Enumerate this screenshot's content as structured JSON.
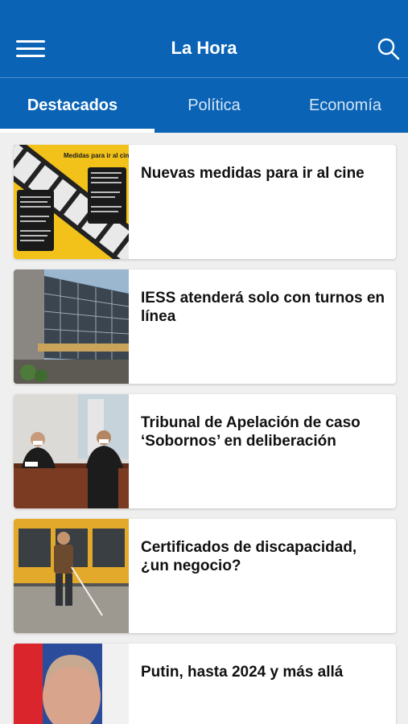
{
  "header": {
    "title": "La Hora",
    "menu_icon": "hamburger-menu-icon",
    "search_icon": "search-icon",
    "background_color": "#0a63b5"
  },
  "tabs": [
    {
      "label": "Destacados",
      "active": true
    },
    {
      "label": "Política",
      "active": false
    },
    {
      "label": "Economía",
      "active": false
    }
  ],
  "articles": [
    {
      "title": "Nuevas medidas para ir al cine",
      "thumbnail": {
        "heading": "Medidas para ir al cin"
      }
    },
    {
      "title": "IESS atenderá solo con turnos en línea"
    },
    {
      "title": "Tribunal de Apelación de caso ‘Sobornos’ en deliberación"
    },
    {
      "title": "Certificados de discapacidad, ¿un negocio?"
    },
    {
      "title": "Putin, hasta 2024 y más allá"
    }
  ]
}
